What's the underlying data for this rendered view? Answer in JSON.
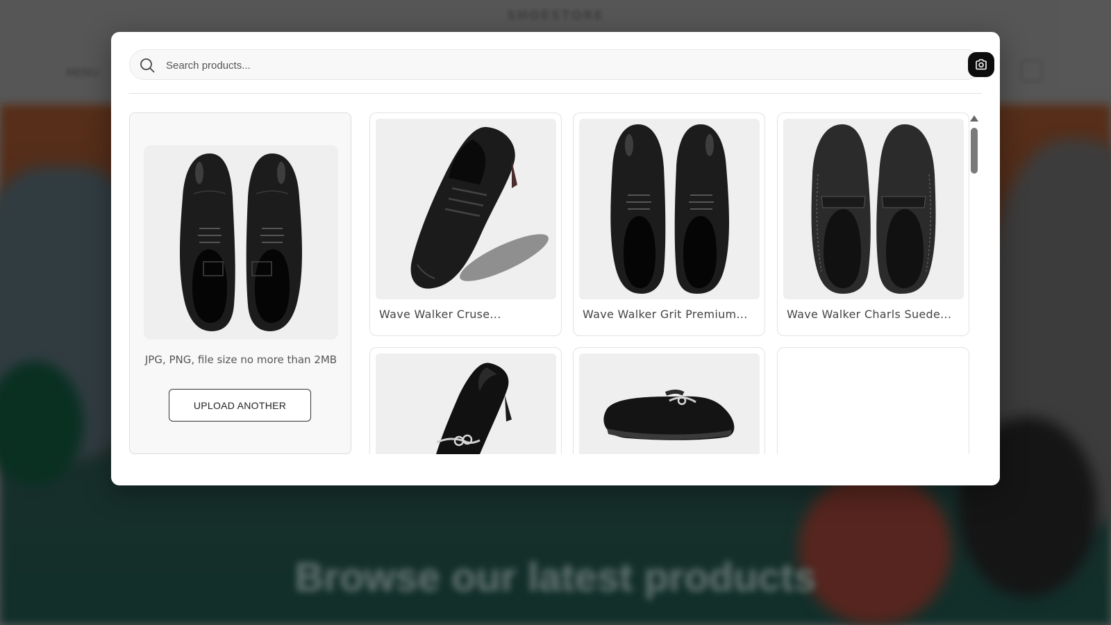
{
  "background": {
    "logo_text": "SHOESTORE",
    "menu_text": "MENU",
    "hero_title": "Browse our latest products"
  },
  "search": {
    "placeholder": "Search products...",
    "value": "",
    "camera_icon": "camera-icon",
    "search_icon": "search-icon"
  },
  "upload": {
    "hint": "JPG, PNG, file size no more than 2MB",
    "button_label": "UPLOAD ANOTHER"
  },
  "products": [
    {
      "title": "Wave Walker Cruse..."
    },
    {
      "title": "Wave Walker Grit Premium..."
    },
    {
      "title": "Wave Walker Charls Suede..."
    },
    {
      "title": ""
    },
    {
      "title": ""
    },
    {
      "title": ""
    }
  ],
  "colors": {
    "accent": "#0d0d0d",
    "card_border": "#e2e2e2",
    "image_bg": "#efefef"
  }
}
